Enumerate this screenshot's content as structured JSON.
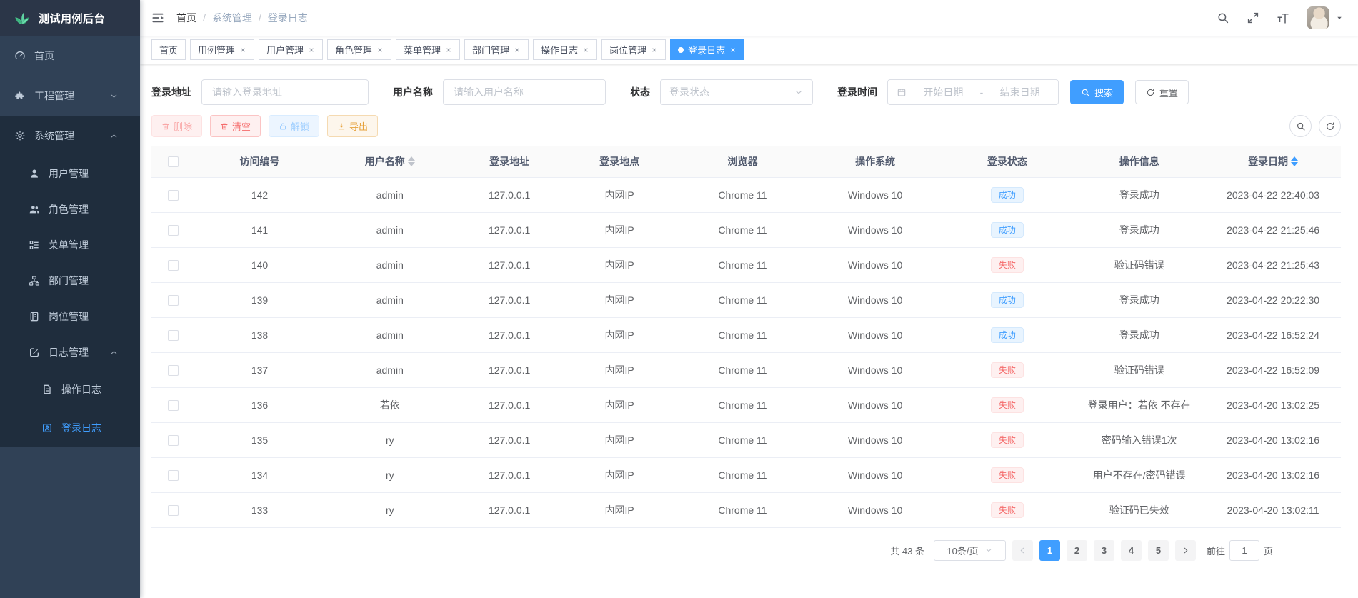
{
  "app": {
    "logo_title": "测试用例后台"
  },
  "colors": {
    "accent": "#409eff",
    "sidebar_bg": "#304156",
    "sidebar_submenu_bg": "#1f2d3d",
    "success_badge_bg": "#e8f4ff",
    "success_badge_text": "#409eff",
    "danger_badge_bg": "#fef0f0",
    "danger_badge_text": "#f56c6c",
    "warning_text": "#e6a23c"
  },
  "header": {
    "breadcrumb": [
      "首页",
      "系统管理",
      "登录日志"
    ],
    "action_icons": [
      "search-icon",
      "fullscreen-icon",
      "font-size-icon",
      "avatar",
      "caret-down-icon"
    ]
  },
  "tabs": [
    {
      "id": "home",
      "label": "首页",
      "closable": false,
      "active": false
    },
    {
      "id": "usecase",
      "label": "用例管理",
      "closable": true,
      "active": false
    },
    {
      "id": "user",
      "label": "用户管理",
      "closable": true,
      "active": false
    },
    {
      "id": "role",
      "label": "角色管理",
      "closable": true,
      "active": false
    },
    {
      "id": "menu",
      "label": "菜单管理",
      "closable": true,
      "active": false
    },
    {
      "id": "dept",
      "label": "部门管理",
      "closable": true,
      "active": false
    },
    {
      "id": "operlog",
      "label": "操作日志",
      "closable": true,
      "active": false
    },
    {
      "id": "post",
      "label": "岗位管理",
      "closable": true,
      "active": false
    },
    {
      "id": "logininfor",
      "label": "登录日志",
      "closable": true,
      "active": true
    }
  ],
  "sidebar": {
    "items": [
      {
        "id": "home",
        "label": "首页",
        "icon": "dashboard-icon",
        "level": 1,
        "dark": false,
        "active": false
      },
      {
        "id": "project",
        "label": "工程管理",
        "icon": "puzzle-icon",
        "level": 1,
        "dark": false,
        "active": false,
        "chevron": "down"
      },
      {
        "id": "system",
        "label": "系统管理",
        "icon": "gear-icon",
        "level": 1,
        "dark": true,
        "active": false,
        "chevron": "up"
      },
      {
        "id": "user",
        "label": "用户管理",
        "icon": "user-icon",
        "level": 2,
        "dark": true,
        "active": false
      },
      {
        "id": "role",
        "label": "角色管理",
        "icon": "users-icon",
        "level": 2,
        "dark": true,
        "active": false
      },
      {
        "id": "menu",
        "label": "菜单管理",
        "icon": "menu-tree-icon",
        "level": 2,
        "dark": true,
        "active": false
      },
      {
        "id": "dept",
        "label": "部门管理",
        "icon": "org-icon",
        "level": 2,
        "dark": true,
        "active": false
      },
      {
        "id": "post",
        "label": "岗位管理",
        "icon": "book-icon",
        "level": 2,
        "dark": true,
        "active": false
      },
      {
        "id": "log",
        "label": "日志管理",
        "icon": "log-edit-icon",
        "level": 2,
        "dark": true,
        "active": false,
        "chevron": "up"
      },
      {
        "id": "operlog",
        "label": "操作日志",
        "icon": "document-icon",
        "level": 3,
        "dark": true,
        "active": false
      },
      {
        "id": "logininfor",
        "label": "登录日志",
        "icon": "login-log-icon",
        "level": 3,
        "dark": true,
        "active": true
      }
    ]
  },
  "filters": {
    "fields": [
      {
        "label": "登录地址",
        "type": "input",
        "placeholder": "请输入登录地址"
      },
      {
        "label": "用户名称",
        "type": "input",
        "placeholder": "请输入用户名称"
      },
      {
        "label": "状态",
        "type": "select",
        "placeholder": "登录状态"
      },
      {
        "label": "登录时间",
        "type": "daterange",
        "start_placeholder": "开始日期",
        "separator": "-",
        "end_placeholder": "结束日期"
      }
    ],
    "search_label": "搜索",
    "reset_label": "重置"
  },
  "toolbar": {
    "buttons": [
      {
        "id": "delete",
        "label": "删除",
        "icon": "trash-icon",
        "variant": "danger",
        "disabled": true
      },
      {
        "id": "clean",
        "label": "清空",
        "icon": "trash-icon",
        "variant": "danger",
        "disabled": false
      },
      {
        "id": "unlock",
        "label": "解锁",
        "icon": "unlock-icon",
        "variant": "primary",
        "disabled": true
      },
      {
        "id": "export",
        "label": "导出",
        "icon": "download-icon",
        "variant": "warning",
        "disabled": false
      }
    ],
    "corner_icons": [
      "search-icon",
      "refresh-icon"
    ]
  },
  "table": {
    "columns": [
      {
        "label": "",
        "type": "checkbox"
      },
      {
        "label": "访问编号"
      },
      {
        "label": "用户名称",
        "sortable": true,
        "sort_active": false
      },
      {
        "label": "登录地址"
      },
      {
        "label": "登录地点"
      },
      {
        "label": "浏览器"
      },
      {
        "label": "操作系统"
      },
      {
        "label": "登录状态"
      },
      {
        "label": "操作信息"
      },
      {
        "label": "登录日期",
        "sortable": true,
        "sort_active": true
      }
    ],
    "rows": [
      {
        "id": "142",
        "user": "admin",
        "address": "127.0.0.1",
        "location": "内网IP",
        "browser": "Chrome 11",
        "os": "Windows 10",
        "status": "成功",
        "status_type": "success",
        "message": "登录成功",
        "date": "2023-04-22 22:40:03"
      },
      {
        "id": "141",
        "user": "admin",
        "address": "127.0.0.1",
        "location": "内网IP",
        "browser": "Chrome 11",
        "os": "Windows 10",
        "status": "成功",
        "status_type": "success",
        "message": "登录成功",
        "date": "2023-04-22 21:25:46"
      },
      {
        "id": "140",
        "user": "admin",
        "address": "127.0.0.1",
        "location": "内网IP",
        "browser": "Chrome 11",
        "os": "Windows 10",
        "status": "失败",
        "status_type": "danger",
        "message": "验证码错误",
        "date": "2023-04-22 21:25:43"
      },
      {
        "id": "139",
        "user": "admin",
        "address": "127.0.0.1",
        "location": "内网IP",
        "browser": "Chrome 11",
        "os": "Windows 10",
        "status": "成功",
        "status_type": "success",
        "message": "登录成功",
        "date": "2023-04-22 20:22:30"
      },
      {
        "id": "138",
        "user": "admin",
        "address": "127.0.0.1",
        "location": "内网IP",
        "browser": "Chrome 11",
        "os": "Windows 10",
        "status": "成功",
        "status_type": "success",
        "message": "登录成功",
        "date": "2023-04-22 16:52:24"
      },
      {
        "id": "137",
        "user": "admin",
        "address": "127.0.0.1",
        "location": "内网IP",
        "browser": "Chrome 11",
        "os": "Windows 10",
        "status": "失败",
        "status_type": "danger",
        "message": "验证码错误",
        "date": "2023-04-22 16:52:09"
      },
      {
        "id": "136",
        "user": "若依",
        "address": "127.0.0.1",
        "location": "内网IP",
        "browser": "Chrome 11",
        "os": "Windows 10",
        "status": "失败",
        "status_type": "danger",
        "message": "登录用户：若依 不存在",
        "date": "2023-04-20 13:02:25"
      },
      {
        "id": "135",
        "user": "ry",
        "address": "127.0.0.1",
        "location": "内网IP",
        "browser": "Chrome 11",
        "os": "Windows 10",
        "status": "失败",
        "status_type": "danger",
        "message": "密码输入错误1次",
        "date": "2023-04-20 13:02:16"
      },
      {
        "id": "134",
        "user": "ry",
        "address": "127.0.0.1",
        "location": "内网IP",
        "browser": "Chrome 11",
        "os": "Windows 10",
        "status": "失败",
        "status_type": "danger",
        "message": "用户不存在/密码错误",
        "date": "2023-04-20 13:02:16"
      },
      {
        "id": "133",
        "user": "ry",
        "address": "127.0.0.1",
        "location": "内网IP",
        "browser": "Chrome 11",
        "os": "Windows 10",
        "status": "失败",
        "status_type": "danger",
        "message": "验证码已失效",
        "date": "2023-04-20 13:02:11"
      }
    ]
  },
  "pagination": {
    "total": "共 43 条",
    "page_size": "10条/页",
    "pages": [
      "1",
      "2",
      "3",
      "4",
      "5"
    ],
    "active_page": "1",
    "goto_label": "前往",
    "goto_value": "1",
    "goto_suffix": "页"
  }
}
